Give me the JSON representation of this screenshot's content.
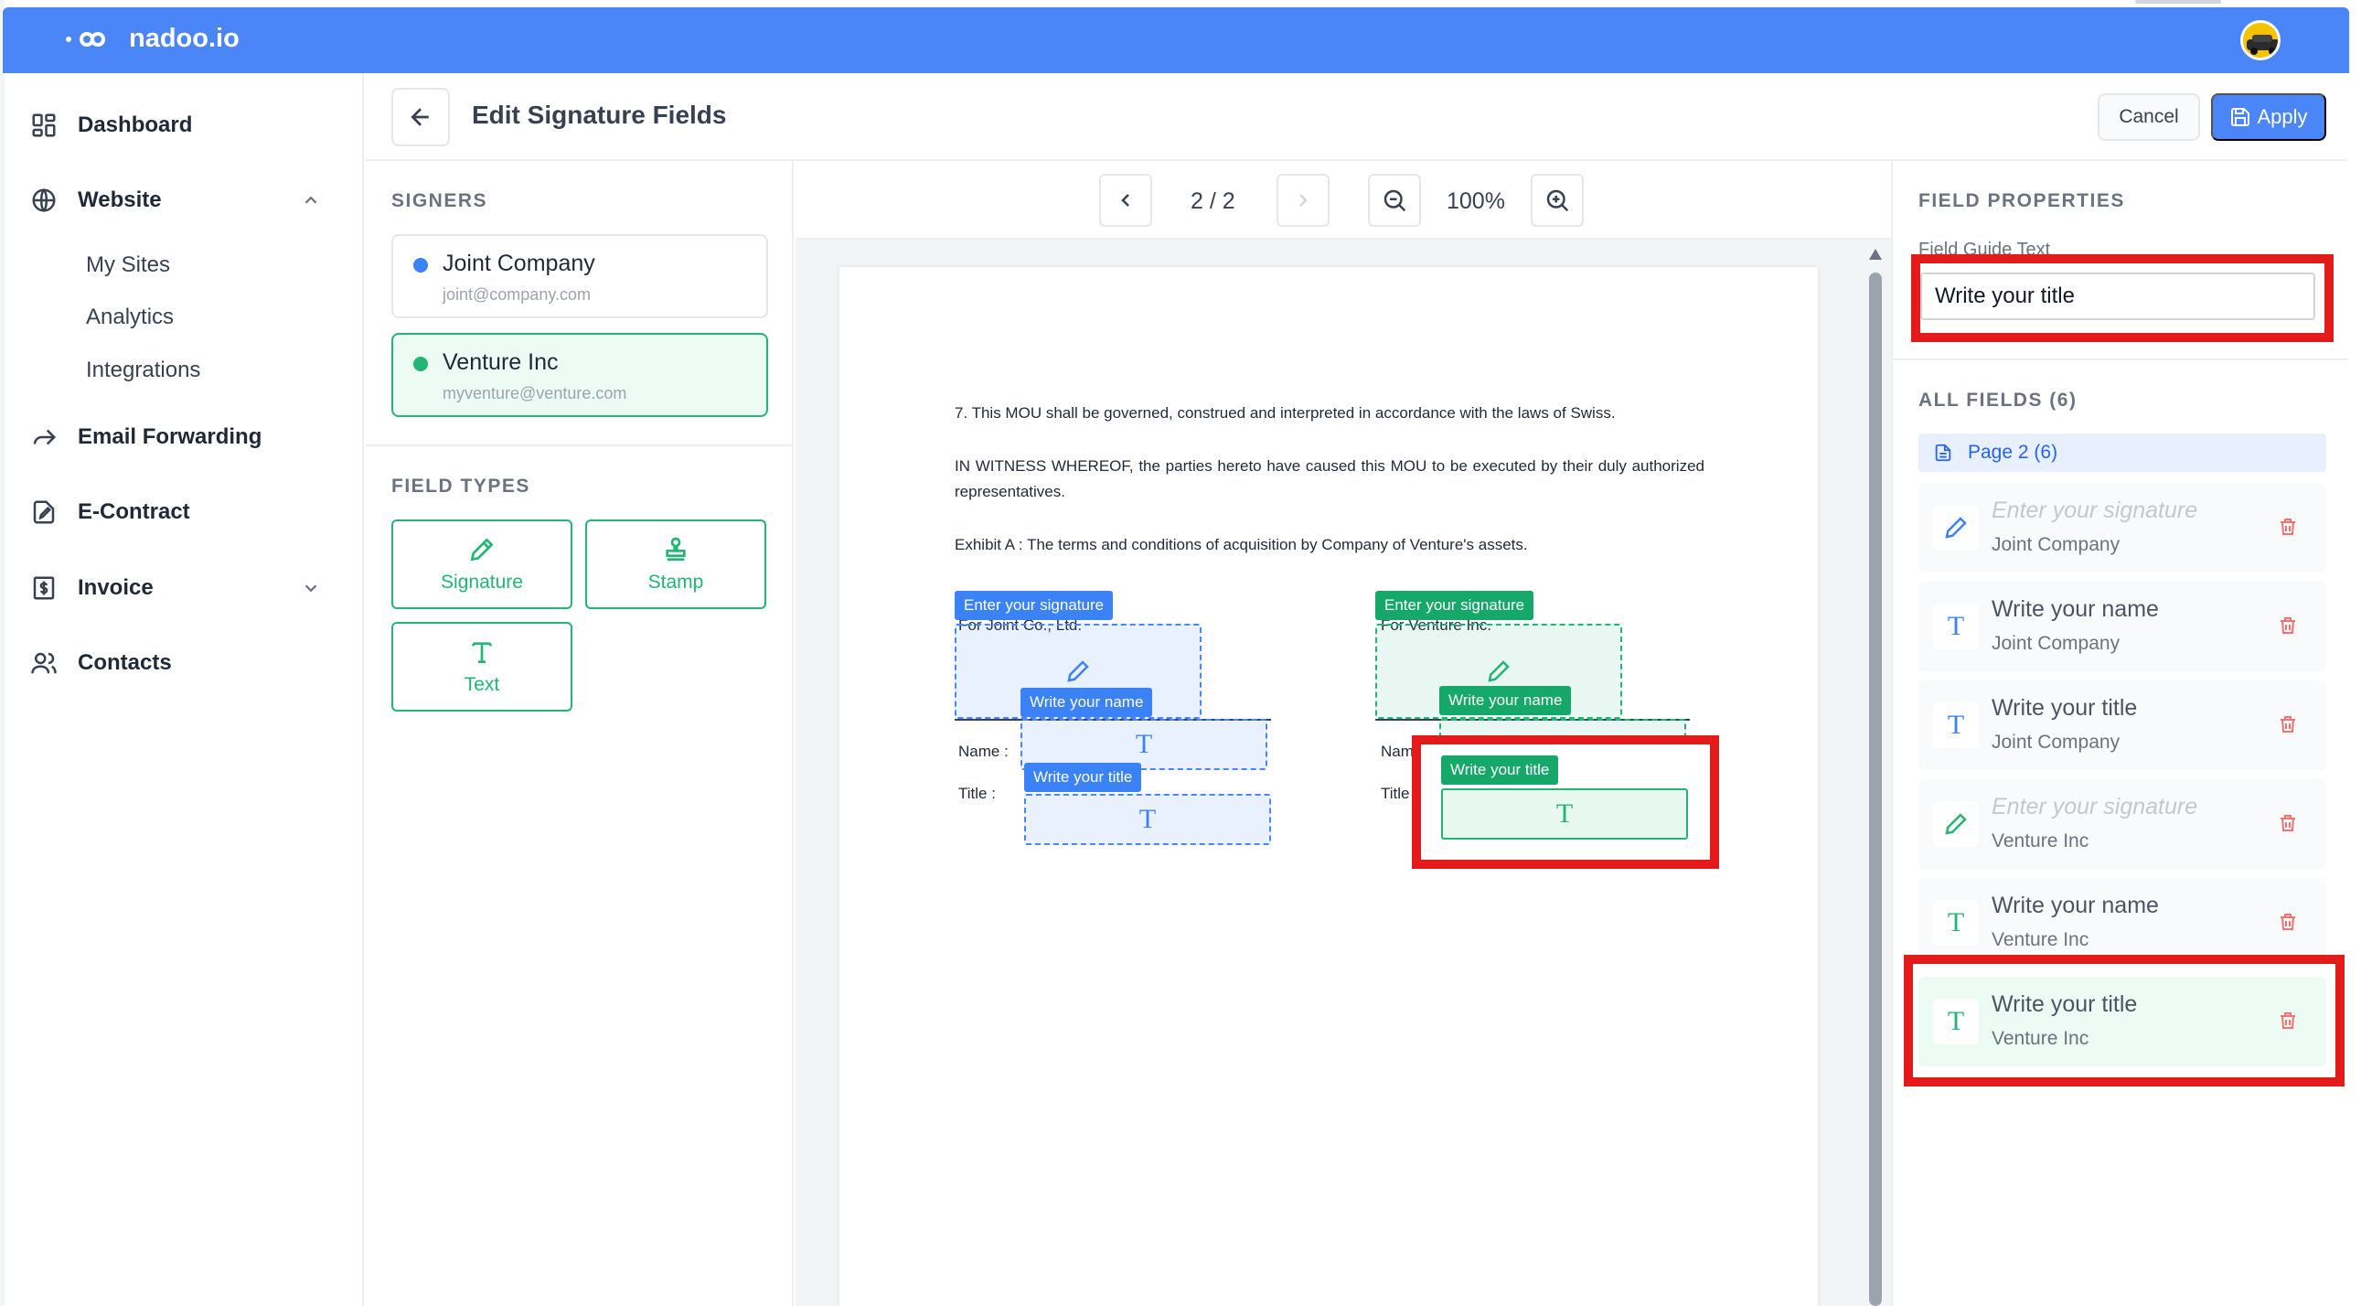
{
  "app": {
    "brand": "nadoo.io"
  },
  "sidebar": {
    "items": [
      {
        "label": "Dashboard",
        "icon": "dashboard-icon"
      },
      {
        "label": "Website",
        "icon": "globe-icon",
        "expanded": true,
        "children": [
          "My Sites",
          "Analytics",
          "Integrations"
        ]
      },
      {
        "label": "Email Forwarding",
        "icon": "forward-icon"
      },
      {
        "label": "E-Contract",
        "icon": "contract-icon"
      },
      {
        "label": "Invoice",
        "icon": "invoice-icon",
        "expanded": false
      },
      {
        "label": "Contacts",
        "icon": "contacts-icon"
      }
    ]
  },
  "header": {
    "title": "Edit Signature Fields",
    "cancel_label": "Cancel",
    "apply_label": "Apply"
  },
  "signers": {
    "label": "SIGNERS",
    "list": [
      {
        "name": "Joint Company",
        "email": "joint@company.com",
        "color": "#3b82f6"
      },
      {
        "name": "Venture Inc",
        "email": "myventure@venture.com",
        "color": "#22b573"
      }
    ]
  },
  "field_types": {
    "label": "FIELD TYPES",
    "signature": "Signature",
    "stamp": "Stamp",
    "text": "Text"
  },
  "viewer": {
    "page_indicator": "2 / 2",
    "zoom": "100%"
  },
  "document": {
    "para1": "7. This MOU shall be governed, construed and interpreted in accordance with the laws of Swiss.",
    "para2": "IN WITNESS WHEREOF, the parties hereto have caused this MOU to be executed by their duly authorized representatives.",
    "para3": "Exhibit A : The terms and conditions of acquisition by Company of Venture's assets.",
    "left_party": "For Joint Co., Ltd.",
    "right_party": "For Venture Inc.",
    "name_label_left": "Name :",
    "title_label_left": "Title :",
    "name_label_right": "Nam",
    "title_label_right": "Title",
    "tags": {
      "signature": "Enter your signature",
      "name": "Write your name",
      "title": "Write your title"
    }
  },
  "properties": {
    "label": "FIELD PROPERTIES",
    "guide_label": "Field Guide Text",
    "guide_value": "Write your title"
  },
  "all_fields": {
    "label": "ALL FIELDS (6)",
    "page_group": "Page 2 (6)",
    "items": [
      {
        "title": "Enter your signature",
        "owner": "Joint Company",
        "type": "signature",
        "color": "#3b82f6"
      },
      {
        "title": "Write your name",
        "owner": "Joint Company",
        "type": "text",
        "color": "#3b82f6"
      },
      {
        "title": "Write your title",
        "owner": "Joint Company",
        "type": "text",
        "color": "#3b82f6"
      },
      {
        "title": "Enter your signature",
        "owner": "Venture Inc",
        "type": "signature",
        "color": "#22b573"
      },
      {
        "title": "Write your name",
        "owner": "Venture Inc",
        "type": "text",
        "color": "#22b573"
      },
      {
        "title": "Write your title",
        "owner": "Venture Inc",
        "type": "text",
        "color": "#22b573"
      }
    ]
  }
}
